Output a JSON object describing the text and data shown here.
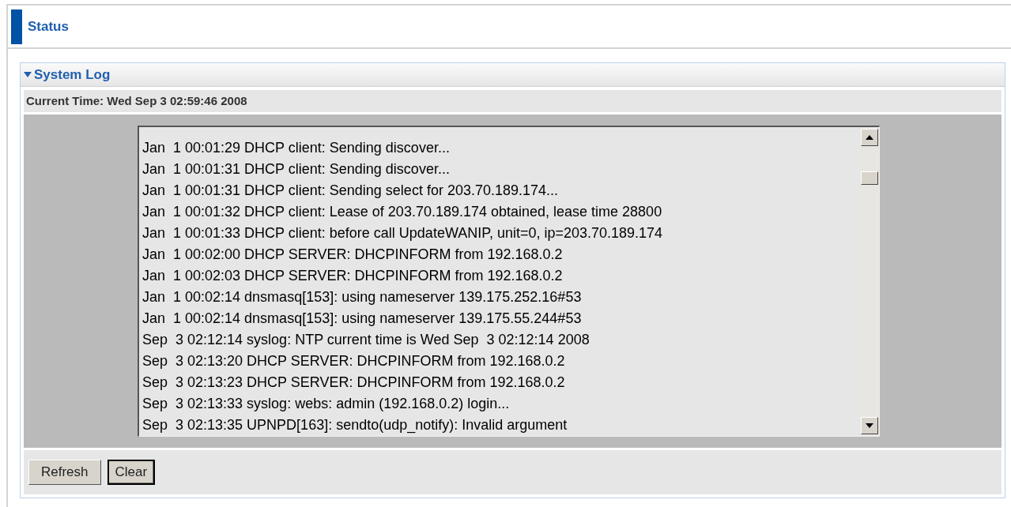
{
  "page": {
    "title": "Status"
  },
  "section": {
    "title": "System Log",
    "expanded": true,
    "current_time": "Current Time: Wed Sep 3 02:59:46 2008",
    "log_lines": [
      "Jan  1 00:01:29 DHCP client: Sending discover...",
      "Jan  1 00:01:31 DHCP client: Sending discover...",
      "Jan  1 00:01:31 DHCP client: Sending select for 203.70.189.174...",
      "Jan  1 00:01:32 DHCP client: Lease of 203.70.189.174 obtained, lease time 28800",
      "Jan  1 00:01:33 DHCP client: before call UpdateWANIP, unit=0, ip=203.70.189.174",
      "Jan  1 00:02:00 DHCP SERVER: DHCPINFORM from 192.168.0.2",
      "Jan  1 00:02:03 DHCP SERVER: DHCPINFORM from 192.168.0.2",
      "Jan  1 00:02:14 dnsmasq[153]: using nameserver 139.175.252.16#53",
      "Jan  1 00:02:14 dnsmasq[153]: using nameserver 139.175.55.244#53",
      "Sep  3 02:12:14 syslog: NTP current time is Wed Sep  3 02:12:14 2008",
      "Sep  3 02:13:20 DHCP SERVER: DHCPINFORM from 192.168.0.2",
      "Sep  3 02:13:23 DHCP SERVER: DHCPINFORM from 192.168.0.2",
      "Sep  3 02:13:33 syslog: webs: admin (192.168.0.2) login...",
      "Sep  3 02:13:35 UPNPD[163]: sendto(udp_notify): Invalid argument"
    ],
    "buttons": [
      {
        "label": "Refresh",
        "focused": false
      },
      {
        "label": "Clear",
        "focused": true
      }
    ]
  }
}
